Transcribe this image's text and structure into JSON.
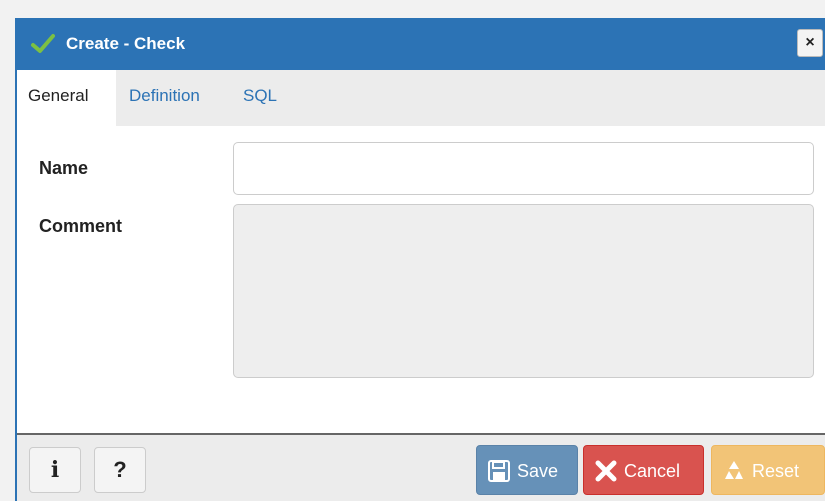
{
  "dialog": {
    "title": "Create - Check",
    "close_label": "×",
    "title_icon": "check-icon"
  },
  "tabs": [
    {
      "label": "General",
      "active": true
    },
    {
      "label": "Definition",
      "active": false
    },
    {
      "label": "SQL",
      "active": false
    }
  ],
  "form": {
    "name_label": "Name",
    "name_value": "",
    "comment_label": "Comment",
    "comment_value": ""
  },
  "footer": {
    "info_label": "i",
    "help_label": "?",
    "save_label": "Save",
    "cancel_label": "Cancel",
    "reset_label": "Reset"
  },
  "colors": {
    "titlebar": "#2c73b5",
    "save": "#6691b8",
    "cancel": "#d9534f",
    "reset": "#f2c477"
  }
}
